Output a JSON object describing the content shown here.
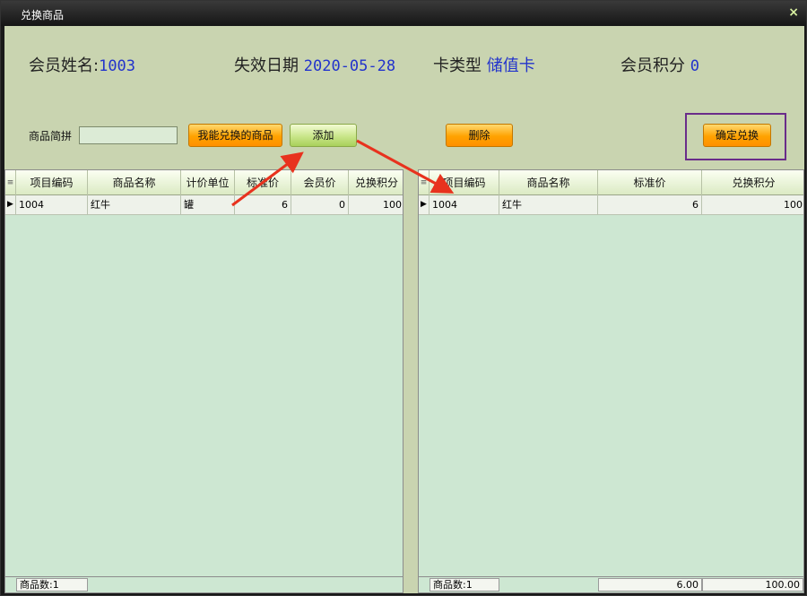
{
  "window": {
    "title": "兑换商品",
    "close_glyph": "×"
  },
  "member": {
    "name_label": "会员姓名:",
    "name_value": "1003",
    "expiry_label": "失效日期",
    "expiry_value": "2020-05-28",
    "card_type_label": "卡类型",
    "card_type_value": "储值卡",
    "points_label": "会员积分",
    "points_value": "0"
  },
  "toolbar": {
    "search_label": "商品简拼",
    "search_value": "",
    "search_placeholder": "",
    "my_items_label": "我能兑换的商品",
    "add_label": "添加",
    "delete_label": "删除",
    "confirm_label": "确定兑换"
  },
  "left_grid": {
    "indicator_header": "≡",
    "columns": [
      "项目编码",
      "商品名称",
      "计价单位",
      "标准价",
      "会员价",
      "兑换积分"
    ],
    "rows": [
      {
        "indicator": "▶",
        "code": "1004",
        "name": "红牛",
        "unit": "罐",
        "std_price": "6",
        "member_price": "0",
        "points": "100"
      }
    ],
    "footer_count": "商品数:1"
  },
  "right_grid": {
    "indicator_header": "≡",
    "columns": [
      "项目编码",
      "商品名称",
      "标准价",
      "兑换积分"
    ],
    "rows": [
      {
        "indicator": "▶",
        "code": "1004",
        "name": "红牛",
        "std_price": "6",
        "points": "100"
      }
    ],
    "footer_count": "商品数:1",
    "footer_price_total": "6.00",
    "footer_points_total": "100.00"
  },
  "colors": {
    "background": "#c9d4b0",
    "grid_background": "#cde7d2",
    "value_blue": "#2233cc",
    "annotation_red": "#e8321e",
    "highlight_purple": "#6a2c8a",
    "button_orange": "#ffa200",
    "button_green": "#c9e68a"
  }
}
